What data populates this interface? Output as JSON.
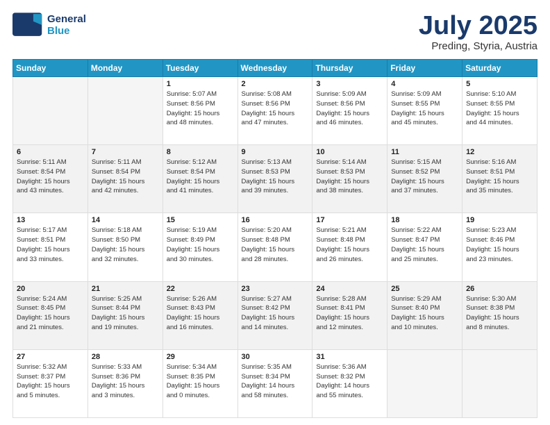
{
  "header": {
    "logo_general": "General",
    "logo_blue": "Blue",
    "month_title": "July 2025",
    "location": "Preding, Styria, Austria"
  },
  "days_of_week": [
    "Sunday",
    "Monday",
    "Tuesday",
    "Wednesday",
    "Thursday",
    "Friday",
    "Saturday"
  ],
  "weeks": [
    [
      {
        "day": "",
        "lines": []
      },
      {
        "day": "",
        "lines": []
      },
      {
        "day": "1",
        "lines": [
          "Sunrise: 5:07 AM",
          "Sunset: 8:56 PM",
          "Daylight: 15 hours",
          "and 48 minutes."
        ]
      },
      {
        "day": "2",
        "lines": [
          "Sunrise: 5:08 AM",
          "Sunset: 8:56 PM",
          "Daylight: 15 hours",
          "and 47 minutes."
        ]
      },
      {
        "day": "3",
        "lines": [
          "Sunrise: 5:09 AM",
          "Sunset: 8:56 PM",
          "Daylight: 15 hours",
          "and 46 minutes."
        ]
      },
      {
        "day": "4",
        "lines": [
          "Sunrise: 5:09 AM",
          "Sunset: 8:55 PM",
          "Daylight: 15 hours",
          "and 45 minutes."
        ]
      },
      {
        "day": "5",
        "lines": [
          "Sunrise: 5:10 AM",
          "Sunset: 8:55 PM",
          "Daylight: 15 hours",
          "and 44 minutes."
        ]
      }
    ],
    [
      {
        "day": "6",
        "lines": [
          "Sunrise: 5:11 AM",
          "Sunset: 8:54 PM",
          "Daylight: 15 hours",
          "and 43 minutes."
        ]
      },
      {
        "day": "7",
        "lines": [
          "Sunrise: 5:11 AM",
          "Sunset: 8:54 PM",
          "Daylight: 15 hours",
          "and 42 minutes."
        ]
      },
      {
        "day": "8",
        "lines": [
          "Sunrise: 5:12 AM",
          "Sunset: 8:54 PM",
          "Daylight: 15 hours",
          "and 41 minutes."
        ]
      },
      {
        "day": "9",
        "lines": [
          "Sunrise: 5:13 AM",
          "Sunset: 8:53 PM",
          "Daylight: 15 hours",
          "and 39 minutes."
        ]
      },
      {
        "day": "10",
        "lines": [
          "Sunrise: 5:14 AM",
          "Sunset: 8:53 PM",
          "Daylight: 15 hours",
          "and 38 minutes."
        ]
      },
      {
        "day": "11",
        "lines": [
          "Sunrise: 5:15 AM",
          "Sunset: 8:52 PM",
          "Daylight: 15 hours",
          "and 37 minutes."
        ]
      },
      {
        "day": "12",
        "lines": [
          "Sunrise: 5:16 AM",
          "Sunset: 8:51 PM",
          "Daylight: 15 hours",
          "and 35 minutes."
        ]
      }
    ],
    [
      {
        "day": "13",
        "lines": [
          "Sunrise: 5:17 AM",
          "Sunset: 8:51 PM",
          "Daylight: 15 hours",
          "and 33 minutes."
        ]
      },
      {
        "day": "14",
        "lines": [
          "Sunrise: 5:18 AM",
          "Sunset: 8:50 PM",
          "Daylight: 15 hours",
          "and 32 minutes."
        ]
      },
      {
        "day": "15",
        "lines": [
          "Sunrise: 5:19 AM",
          "Sunset: 8:49 PM",
          "Daylight: 15 hours",
          "and 30 minutes."
        ]
      },
      {
        "day": "16",
        "lines": [
          "Sunrise: 5:20 AM",
          "Sunset: 8:48 PM",
          "Daylight: 15 hours",
          "and 28 minutes."
        ]
      },
      {
        "day": "17",
        "lines": [
          "Sunrise: 5:21 AM",
          "Sunset: 8:48 PM",
          "Daylight: 15 hours",
          "and 26 minutes."
        ]
      },
      {
        "day": "18",
        "lines": [
          "Sunrise: 5:22 AM",
          "Sunset: 8:47 PM",
          "Daylight: 15 hours",
          "and 25 minutes."
        ]
      },
      {
        "day": "19",
        "lines": [
          "Sunrise: 5:23 AM",
          "Sunset: 8:46 PM",
          "Daylight: 15 hours",
          "and 23 minutes."
        ]
      }
    ],
    [
      {
        "day": "20",
        "lines": [
          "Sunrise: 5:24 AM",
          "Sunset: 8:45 PM",
          "Daylight: 15 hours",
          "and 21 minutes."
        ]
      },
      {
        "day": "21",
        "lines": [
          "Sunrise: 5:25 AM",
          "Sunset: 8:44 PM",
          "Daylight: 15 hours",
          "and 19 minutes."
        ]
      },
      {
        "day": "22",
        "lines": [
          "Sunrise: 5:26 AM",
          "Sunset: 8:43 PM",
          "Daylight: 15 hours",
          "and 16 minutes."
        ]
      },
      {
        "day": "23",
        "lines": [
          "Sunrise: 5:27 AM",
          "Sunset: 8:42 PM",
          "Daylight: 15 hours",
          "and 14 minutes."
        ]
      },
      {
        "day": "24",
        "lines": [
          "Sunrise: 5:28 AM",
          "Sunset: 8:41 PM",
          "Daylight: 15 hours",
          "and 12 minutes."
        ]
      },
      {
        "day": "25",
        "lines": [
          "Sunrise: 5:29 AM",
          "Sunset: 8:40 PM",
          "Daylight: 15 hours",
          "and 10 minutes."
        ]
      },
      {
        "day": "26",
        "lines": [
          "Sunrise: 5:30 AM",
          "Sunset: 8:38 PM",
          "Daylight: 15 hours",
          "and 8 minutes."
        ]
      }
    ],
    [
      {
        "day": "27",
        "lines": [
          "Sunrise: 5:32 AM",
          "Sunset: 8:37 PM",
          "Daylight: 15 hours",
          "and 5 minutes."
        ]
      },
      {
        "day": "28",
        "lines": [
          "Sunrise: 5:33 AM",
          "Sunset: 8:36 PM",
          "Daylight: 15 hours",
          "and 3 minutes."
        ]
      },
      {
        "day": "29",
        "lines": [
          "Sunrise: 5:34 AM",
          "Sunset: 8:35 PM",
          "Daylight: 15 hours",
          "and 0 minutes."
        ]
      },
      {
        "day": "30",
        "lines": [
          "Sunrise: 5:35 AM",
          "Sunset: 8:34 PM",
          "Daylight: 14 hours",
          "and 58 minutes."
        ]
      },
      {
        "day": "31",
        "lines": [
          "Sunrise: 5:36 AM",
          "Sunset: 8:32 PM",
          "Daylight: 14 hours",
          "and 55 minutes."
        ]
      },
      {
        "day": "",
        "lines": []
      },
      {
        "day": "",
        "lines": []
      }
    ]
  ]
}
